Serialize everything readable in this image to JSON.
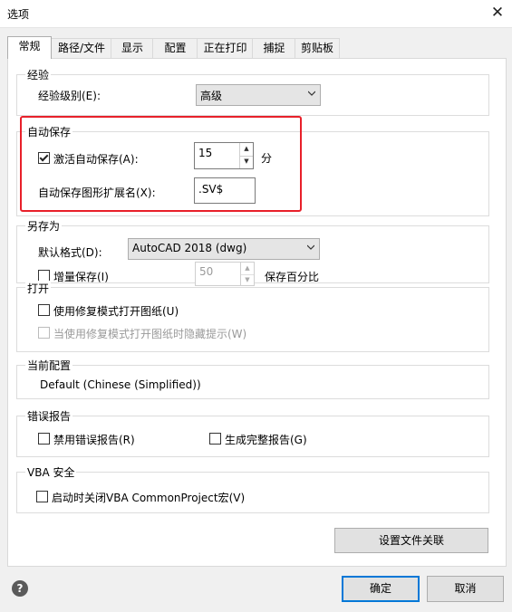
{
  "window": {
    "title": "选项",
    "close_glyph": "✕"
  },
  "tabs": [
    "常规",
    "路径/文件",
    "显示",
    "配置",
    "正在打印",
    "捕捉",
    "剪贴板"
  ],
  "experience": {
    "group_label": "经验",
    "level_label": "经验级别(E):",
    "level_value": "高级"
  },
  "autosave": {
    "group_label": "自动保存",
    "activate_label": "激活自动保存(A):",
    "activate_checked": true,
    "minutes_value": "15",
    "minutes_unit": "分",
    "ext_label": "自动保存图形扩展名(X):",
    "ext_value": ".SV$"
  },
  "saveas": {
    "group_label": "另存为",
    "format_label": "默认格式(D):",
    "format_value": "AutoCAD 2018 (dwg)",
    "incremental_label": "增量保存(I)",
    "incremental_checked": false,
    "percent_value": "50",
    "percent_label": "保存百分比"
  },
  "open": {
    "group_label": "打开",
    "repair_label": "使用修复模式打开图纸(U)",
    "hide_label": "当使用修复模式打开图纸时隐藏提示(W)"
  },
  "profile": {
    "group_label": "当前配置",
    "value": "Default (Chinese (Simplified))"
  },
  "errors": {
    "group_label": "错误报告",
    "disable_label": "禁用错误报告(R)",
    "full_label": "生成完整报告(G)"
  },
  "vba": {
    "group_label": "VBA 安全",
    "close_label": "启动时关闭VBA CommonProject宏(V)"
  },
  "buttons": {
    "file_assoc": "设置文件关联",
    "ok": "确定",
    "cancel": "取消",
    "help": "?"
  },
  "icons": {
    "help": "help-circle-icon",
    "close": "close-icon",
    "dropdown": "chevron-down-icon",
    "spin_up": "arrow-up-icon",
    "spin_down": "arrow-down-icon"
  }
}
